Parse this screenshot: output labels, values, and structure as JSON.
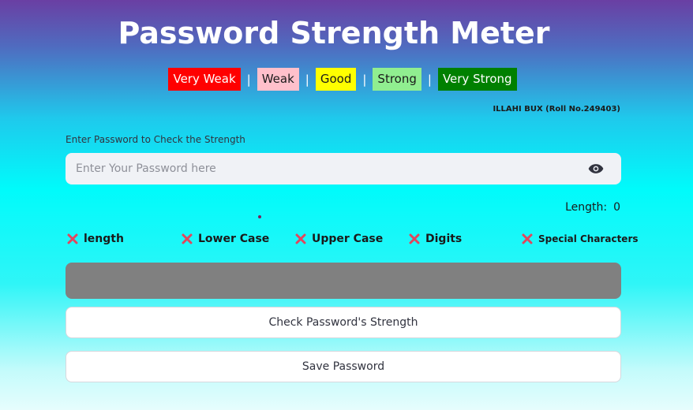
{
  "header": {
    "title": "Password Strength Meter",
    "author": "ILLAHI BUX (Roll No.249403)"
  },
  "legend": {
    "separator": "|",
    "items": [
      {
        "label": "Very Weak",
        "bg": "#ff0000",
        "fg": "#ffffff"
      },
      {
        "label": "Weak",
        "bg": "#ffc0cb",
        "fg": "#1a1a1a"
      },
      {
        "label": "Good",
        "bg": "#ffff00",
        "fg": "#1a1a1a"
      },
      {
        "label": "Strong",
        "bg": "#90ee90",
        "fg": "#1a1a1a"
      },
      {
        "label": "Very Strong",
        "bg": "#008000",
        "fg": "#ffffff"
      }
    ]
  },
  "form": {
    "label": "Enter Password to Check the Strength",
    "value": "",
    "placeholder": "Enter Your Password here",
    "visibility_icon": "eye-icon"
  },
  "length": {
    "label": "Length:",
    "value": "0"
  },
  "criteria": [
    {
      "label": "length",
      "icon": "cross-icon"
    },
    {
      "label": "Lower Case",
      "icon": "cross-icon"
    },
    {
      "label": "Upper Case",
      "icon": "cross-icon"
    },
    {
      "label": "Digits",
      "icon": "cross-icon"
    },
    {
      "label": "Special Characters",
      "icon": "cross-icon"
    }
  ],
  "strength_bar": {
    "color": "#808080"
  },
  "buttons": {
    "check": "Check Password's Strength",
    "save": "Save Password"
  },
  "colors": {
    "cross": "#e0475e"
  }
}
